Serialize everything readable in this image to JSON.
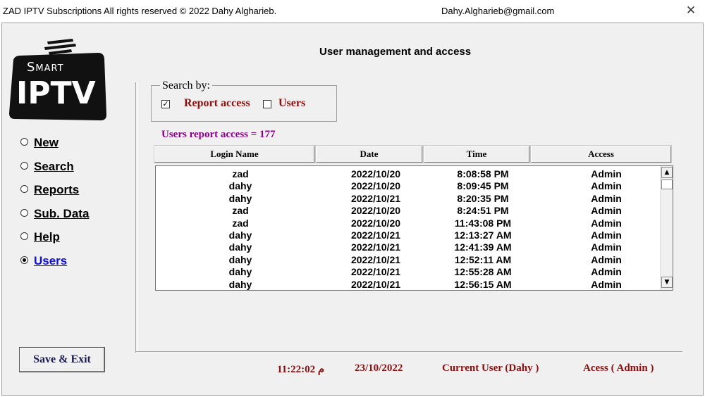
{
  "titlebar": {
    "left_text": "ZAD IPTV Subscriptions All rights reserved © 2022 Dahy Algharieb.",
    "email": "Dahy.Algharieb@gmail.com",
    "close_glyph": "✕"
  },
  "logo": {
    "line1": "Smart",
    "line2": "IPTV",
    "icon": "tv-antenna-logo"
  },
  "heading": "User management and access",
  "nav": [
    {
      "label": "New",
      "selected": false
    },
    {
      "label": "Search",
      "selected": false
    },
    {
      "label": "Reports",
      "selected": false
    },
    {
      "label": "Sub. Data",
      "selected": false
    },
    {
      "label": "Help",
      "selected": false
    },
    {
      "label": "Users",
      "selected": true
    }
  ],
  "search": {
    "legend": "Search by:",
    "report_access": {
      "label": "Report access",
      "checked": true
    },
    "users": {
      "label": "Users",
      "checked": false
    }
  },
  "count_label": "Users report access = 177",
  "table": {
    "columns": [
      "Login Name",
      "Date",
      "Time",
      "Access"
    ],
    "rows": [
      [
        "zad",
        "2022/10/20",
        "8:08:58 PM",
        "Admin"
      ],
      [
        "dahy",
        "2022/10/20",
        "8:09:45 PM",
        "Admin"
      ],
      [
        "dahy",
        "2022/10/21",
        "8:20:35 PM",
        "Admin"
      ],
      [
        "zad",
        "2022/10/20",
        "8:24:51 PM",
        "Admin"
      ],
      [
        "zad",
        "2022/10/20",
        "11:43:08 PM",
        "Admin"
      ],
      [
        "dahy",
        "2022/10/21",
        "12:13:27 AM",
        "Admin"
      ],
      [
        "dahy",
        "2022/10/21",
        "12:41:39 AM",
        "Admin"
      ],
      [
        "dahy",
        "2022/10/21",
        "12:52:11 AM",
        "Admin"
      ],
      [
        "dahy",
        "2022/10/21",
        "12:55:28 AM",
        "Admin"
      ],
      [
        "dahy",
        "2022/10/21",
        "12:56:15 AM",
        "Admin"
      ]
    ]
  },
  "buttons": {
    "save_exit": "Save & Exit"
  },
  "status": {
    "time": "11:22:02 م",
    "date": "23/10/2022",
    "current_user": "Current User (Dahy  )",
    "access": "Acess ( Admin )"
  },
  "colors": {
    "status_text": "#8b1010",
    "count_text": "#8b008b",
    "active_nav": "#1010e0"
  }
}
